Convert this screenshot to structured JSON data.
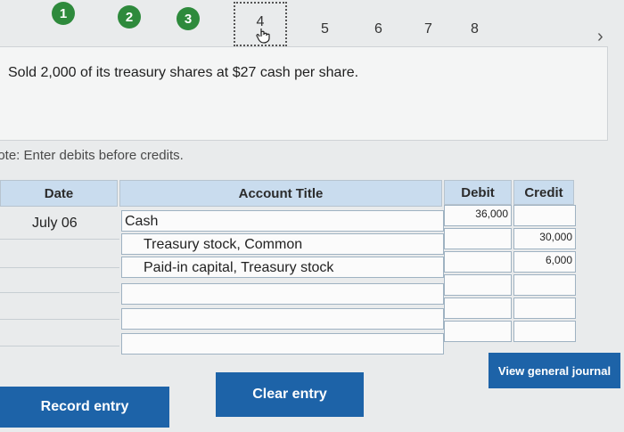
{
  "steps": {
    "completed": [
      "1",
      "2",
      "3"
    ],
    "current": "4",
    "upcoming": [
      "5",
      "6",
      "7",
      "8"
    ]
  },
  "question": {
    "text": "Sold 2,000 of its treasury shares at $27 cash per share."
  },
  "note": "lote: Enter debits before credits.",
  "table": {
    "headers": {
      "date": "Date",
      "account": "Account Title",
      "debit": "Debit",
      "credit": "Credit"
    },
    "date": "July 06",
    "rows": [
      {
        "account": "Cash",
        "debit": "36,000",
        "credit": ""
      },
      {
        "account": "Treasury stock, Common",
        "debit": "",
        "credit": "30,000"
      },
      {
        "account": "Paid-in capital, Treasury stock",
        "debit": "",
        "credit": "6,000"
      },
      {
        "account": "",
        "debit": "",
        "credit": ""
      },
      {
        "account": "",
        "debit": "",
        "credit": ""
      },
      {
        "account": "",
        "debit": "",
        "credit": ""
      }
    ]
  },
  "buttons": {
    "record": "Record entry",
    "clear": "Clear entry",
    "view_journal": "View general journal"
  },
  "colors": {
    "step_green": "#2e8a3c",
    "button_blue": "#1d63a8",
    "header_blue": "#c9dcee"
  }
}
